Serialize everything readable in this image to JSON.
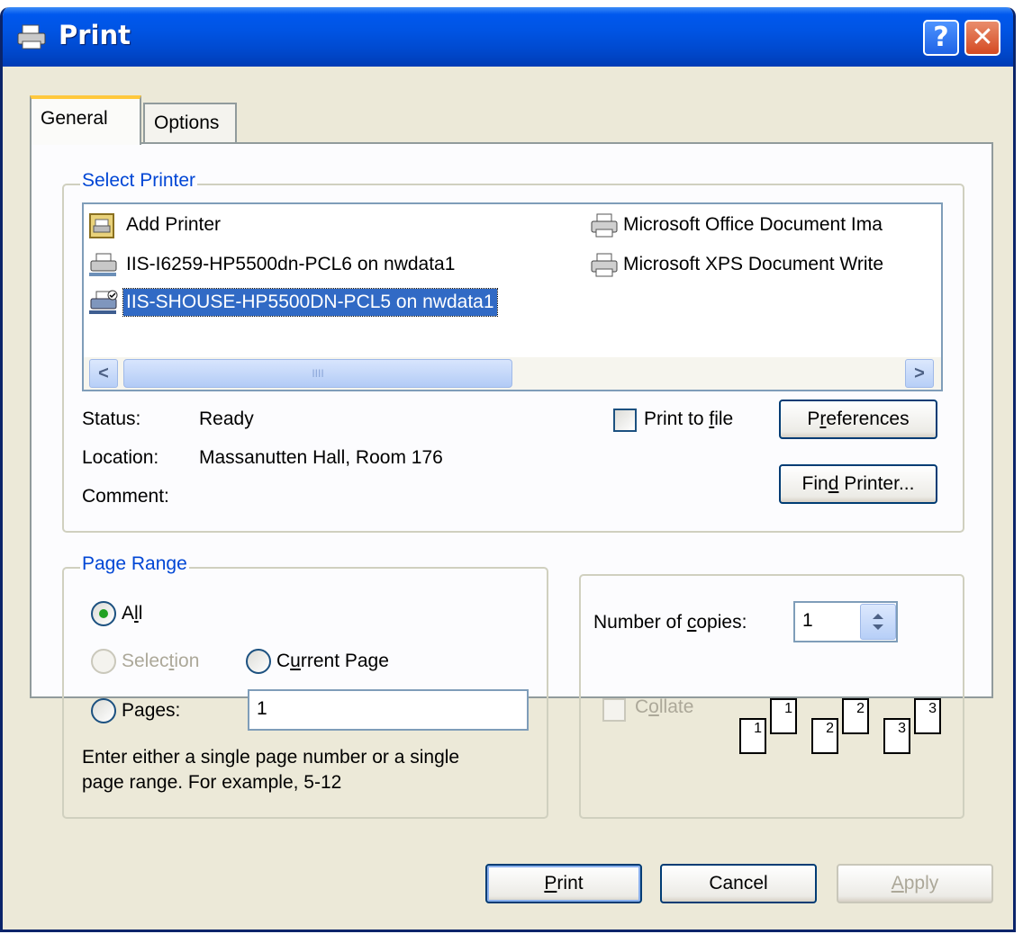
{
  "window": {
    "title": "Print",
    "help_glyph": "?",
    "close_glyph": "✕",
    "icons": [
      "printer-icon",
      "help-icon",
      "close-icon"
    ]
  },
  "tabs": [
    {
      "label": "General",
      "selected": true
    },
    {
      "label": "Options",
      "selected": false
    }
  ],
  "select_printer": {
    "legend": "Select Printer",
    "printers": [
      {
        "label": "Add Printer",
        "icon": "add-printer-icon",
        "selected": false
      },
      {
        "label": "IIS-I6259-HP5500dn-PCL6 on nwdata1",
        "icon": "network-printer-icon",
        "selected": false
      },
      {
        "label": "IIS-SHOUSE-HP5500DN-PCL5 on nwdata1",
        "icon": "default-network-printer-icon",
        "selected": true
      },
      {
        "label": "Microsoft Office Document Ima",
        "icon": "printer-icon",
        "selected": false
      },
      {
        "label": "Microsoft XPS Document Write",
        "icon": "printer-icon",
        "selected": false
      }
    ],
    "scroll_left": "<",
    "scroll_right": ">",
    "scroll_grip": "IIII",
    "status_label": "Status:",
    "status_value": "Ready",
    "location_label": "Location:",
    "location_value": "Massanutten Hall, Room 176",
    "comment_label": "Comment:",
    "comment_value": "",
    "print_to_file": {
      "pre": "Print to ",
      "u": "f",
      "post": "ile",
      "checked": false
    },
    "preferences": {
      "pre": "P",
      "u": "r",
      "post": "eferences"
    },
    "find_printer": {
      "pre": "Fin",
      "u": "d",
      "post": " Printer..."
    }
  },
  "page_range": {
    "legend": "Page Range",
    "all": {
      "pre": "A",
      "u": "l",
      "post": "l",
      "checked": true
    },
    "selection": {
      "pre": "Selec",
      "u": "t",
      "post": "ion",
      "disabled": true
    },
    "current_page": {
      "pre": "C",
      "u": "u",
      "post": "rrent Page"
    },
    "pages": {
      "pre": "Pa",
      "u": "g",
      "post": "es:"
    },
    "pages_value": "1",
    "hint_line1": "Enter either a single page number or a single",
    "hint_line2": "page range.  For example, 5-12"
  },
  "copies": {
    "label_pre": "Number of ",
    "label_u": "c",
    "label_post": "opies:",
    "value": "1",
    "collate": {
      "pre": "C",
      "u": "o",
      "post": "llate",
      "disabled": true,
      "checked": false
    },
    "collate_pages": [
      "1",
      "1",
      "2",
      "2",
      "3",
      "3"
    ]
  },
  "footer": {
    "print": {
      "pre": "",
      "u": "P",
      "post": "rint"
    },
    "cancel": "Cancel",
    "apply": {
      "pre": "",
      "u": "A",
      "post": "pply",
      "disabled": true
    }
  }
}
